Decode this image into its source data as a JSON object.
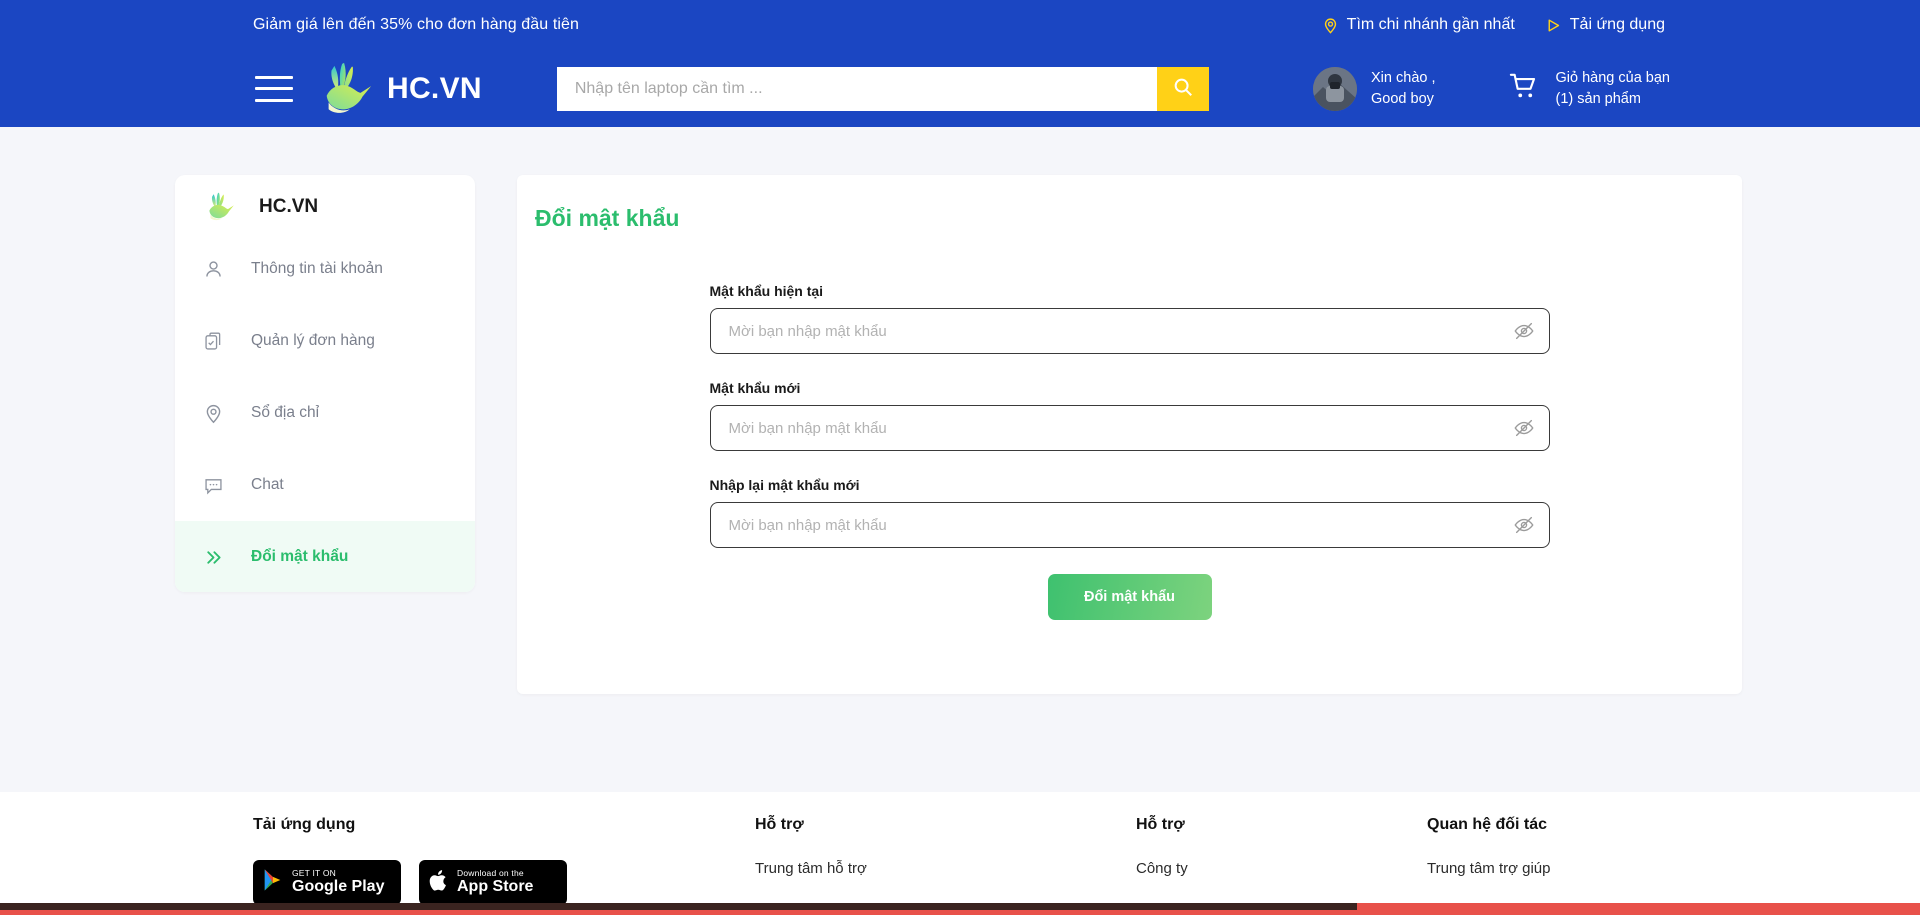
{
  "topbar": {
    "promo": "Giảm giá lên đến 35% cho đơn hàng đầu tiên",
    "find_branch": "Tìm chi nhánh gần nhất",
    "download_app": "Tải ứng dụng",
    "bg_color": "#1b46c2",
    "icon_color": "#ffd117"
  },
  "header": {
    "brand_name": "HC.VN",
    "menu_icon": "hamburger-icon",
    "logo_icon": "hummingbird-logo-icon",
    "search": {
      "placeholder": "Nhập tên laptop cần tìm ...",
      "value": "",
      "button_icon": "search-icon",
      "button_color": "#ffd117"
    },
    "account": {
      "greeting": "Xin chào ,",
      "name": "Good boy",
      "avatar": "user-avatar"
    },
    "cart": {
      "title": "Giỏ hàng của bạn",
      "count_label": "(1) sản phẩm",
      "icon": "shopping-cart-icon"
    }
  },
  "sidebar": {
    "brand_name": "HC.VN",
    "items": [
      {
        "label": "Thông tin tài khoản",
        "icon": "user-icon",
        "active": false
      },
      {
        "label": "Quản lý đơn hàng",
        "icon": "clipboard-check-icon",
        "active": false
      },
      {
        "label": "Sổ địa chỉ",
        "icon": "map-pin-icon",
        "active": false
      },
      {
        "label": "Chat",
        "icon": "chat-bubble-icon",
        "active": false
      },
      {
        "label": "Đổi mật khẩu",
        "icon": "double-chevron-right-icon",
        "active": true
      }
    ],
    "active_color": "#2bbd6d",
    "active_bg": "#f0fbf5"
  },
  "main": {
    "title": "Đổi mật khẩu",
    "title_color": "#2bbd6d",
    "fields": [
      {
        "label": "Mật khẩu hiện tại",
        "placeholder": "Mời bạn nhập mật khẩu",
        "value": "",
        "toggle_icon": "eye-off-icon"
      },
      {
        "label": "Mật khẩu mới",
        "placeholder": "Mời bạn nhập mật khẩu",
        "value": "",
        "toggle_icon": "eye-off-icon"
      },
      {
        "label": "Nhập lại mật khẩu mới",
        "placeholder": "Mời bạn nhập mật khẩu",
        "value": "",
        "toggle_icon": "eye-off-icon"
      }
    ],
    "submit_label": "Đổi mật khẩu",
    "submit_gradient": [
      "#3ec16f",
      "#7dd37e"
    ]
  },
  "footer": {
    "columns": [
      {
        "title": "Tải ứng dụng",
        "badges": [
          {
            "small": "GET IT ON",
            "big": "Google Play",
            "icon": "google-play-icon"
          },
          {
            "small": "Download on the",
            "big": "App Store",
            "icon": "apple-icon"
          }
        ]
      },
      {
        "title": "Hỗ trợ",
        "link": "Trung tâm hỗ trợ"
      },
      {
        "title": "Hỗ trợ",
        "link": "Công ty"
      },
      {
        "title": "Quan hệ đối tác",
        "link": "Trung tâm trợ giúp"
      }
    ]
  },
  "bottom_bars": {
    "red_color": "#e8514a",
    "dark_color": "#3b2420"
  }
}
